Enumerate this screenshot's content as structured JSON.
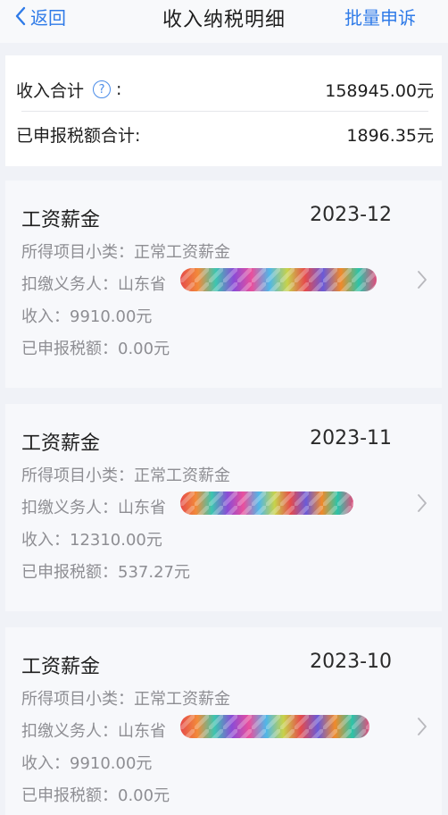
{
  "nav": {
    "back_label": "返回",
    "title": "收入纳税明细",
    "action_label": "批量申诉"
  },
  "summary": {
    "income_total_label": "收入合计",
    "income_total_value": "158945.00元",
    "tax_total_label": "已申报税额合计:",
    "tax_total_value": "1896.35元"
  },
  "records": [
    {
      "category": "工资薪金",
      "period": "2023-12",
      "subcategory": "所得项目小类：正常工资薪金",
      "withholder": "扣缴义务人：山东省",
      "income": "收入：9910.00元",
      "tax": "已申报税额：0.00元"
    },
    {
      "category": "工资薪金",
      "period": "2023-11",
      "subcategory": "所得项目小类：正常工资薪金",
      "withholder": "扣缴义务人：山东省",
      "income": "收入：12310.00元",
      "tax": "已申报税额：537.27元"
    },
    {
      "category": "工资薪金",
      "period": "2023-10",
      "subcategory": "所得项目小类：正常工资薪金",
      "withholder": "扣缴义务人：山东省",
      "income": "收入：9910.00元",
      "tax": "已申报税额：0.00元"
    }
  ],
  "colors": {
    "accent": "#2f7be8",
    "muted_text": "#8e8e93",
    "background": "#f0f2f7"
  },
  "icons": {
    "back": "chevron-left-icon",
    "help": "question-circle-icon",
    "row_chevron": "chevron-right-icon"
  }
}
